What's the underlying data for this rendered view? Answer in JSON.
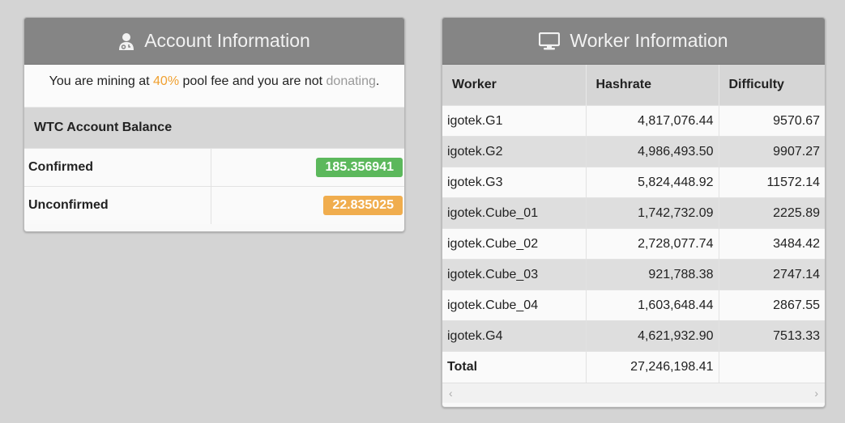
{
  "account": {
    "title": "Account Information",
    "fee_prefix": "You are mining at ",
    "fee_percent": "40%",
    "fee_middle": " pool fee and you are not ",
    "fee_donating": "donating",
    "fee_suffix": ".",
    "balance_heading": "WTC Account Balance",
    "confirmed_label": "Confirmed",
    "confirmed_value": "185.356941",
    "unconfirmed_label": "Unconfirmed",
    "unconfirmed_value": "22.835025"
  },
  "worker": {
    "title": "Worker Information",
    "columns": [
      "Worker",
      "Hashrate",
      "Difficulty"
    ],
    "rows": [
      {
        "name": "igotek.G1",
        "hashrate": "4,817,076.44",
        "difficulty": "9570.67"
      },
      {
        "name": "igotek.G2",
        "hashrate": "4,986,493.50",
        "difficulty": "9907.27"
      },
      {
        "name": "igotek.G3",
        "hashrate": "5,824,448.92",
        "difficulty": "11572.14"
      },
      {
        "name": "igotek.Cube_01",
        "hashrate": "1,742,732.09",
        "difficulty": "2225.89"
      },
      {
        "name": "igotek.Cube_02",
        "hashrate": "2,728,077.74",
        "difficulty": "3484.42"
      },
      {
        "name": "igotek.Cube_03",
        "hashrate": "921,788.38",
        "difficulty": "2747.14"
      },
      {
        "name": "igotek.Cube_04",
        "hashrate": "1,603,648.44",
        "difficulty": "2867.55"
      },
      {
        "name": "igotek.G4",
        "hashrate": "4,621,932.90",
        "difficulty": "7513.33"
      }
    ],
    "total_label": "Total",
    "total_hashrate": "27,246,198.41",
    "total_difficulty": ""
  },
  "icons": {
    "account": "user-doctor-icon",
    "worker": "monitor-icon",
    "scroll_left": "chevron-left-icon",
    "scroll_right": "chevron-right-icon"
  },
  "colors": {
    "header_bg": "#858585",
    "confirmed_badge": "#5cb85c",
    "unconfirmed_badge": "#f0ad4e",
    "fee_highlight": "#f0a030"
  }
}
